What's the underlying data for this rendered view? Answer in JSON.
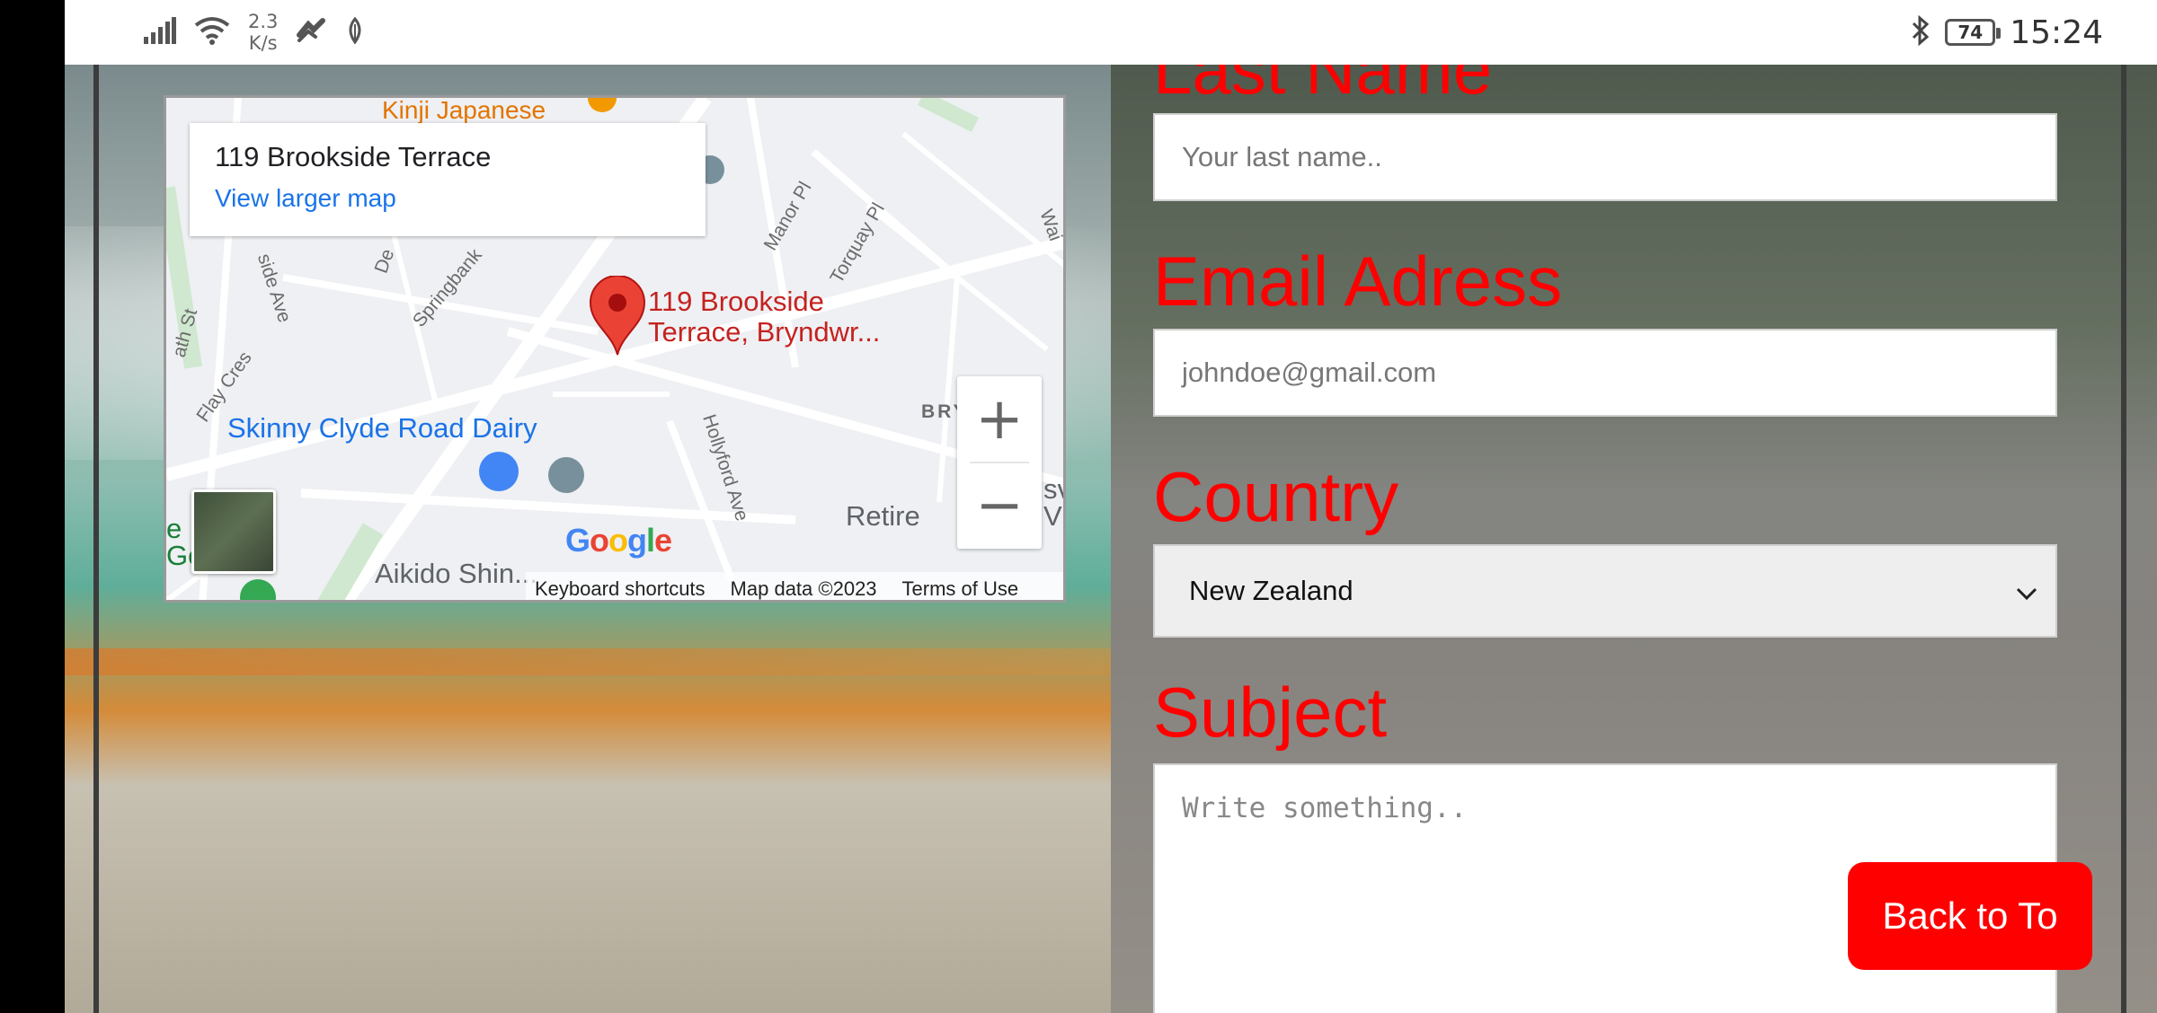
{
  "status_bar": {
    "net_speed_value": "2.3",
    "net_speed_unit": "K/s",
    "battery": "74",
    "time": "15:24"
  },
  "map": {
    "address_title": "119 Brookside Terrace",
    "view_larger_map": "View larger map",
    "pin_label_line1": "119 Brookside",
    "pin_label_line2": "Terrace, Bryndwr...",
    "poi_dairy": "Skinny Clyde Road Dairy",
    "poi_aikido": "Aikido Shin...",
    "poi_retire": "Retire",
    "poi_partial": "e Pl  sc",
    "poi_partial2": "Go    se",
    "street_labels": [
      "Manor Pl",
      "Torquay Pl",
      "Springbank",
      "Flay Cres",
      "Hollyford Ave",
      "side Ave",
      "ath St",
      "BRY",
      "De",
      "Wai",
      "Vi",
      "sv",
      "Kinji Japanese"
    ],
    "google_logo": "Google",
    "zoom_in": "+",
    "zoom_out": "−",
    "attribution": {
      "keyboard": "Keyboard shortcuts",
      "map_data": "Map data ©2023",
      "terms": "Terms of Use"
    }
  },
  "form": {
    "last_name_label": "Last Name",
    "last_name_placeholder": "Your last name..",
    "email_label": "Email Adress",
    "email_placeholder": "johndoe@gmail.com",
    "country_label": "Country",
    "country_value": "New Zealand",
    "subject_label": "Subject",
    "subject_placeholder": "Write something.."
  },
  "back_to_top": "Back to To",
  "colors": {
    "label_red": "#ff0000",
    "button_red": "#ff0000",
    "link_blue": "#1a73e8",
    "pin_red": "#ea4335"
  }
}
